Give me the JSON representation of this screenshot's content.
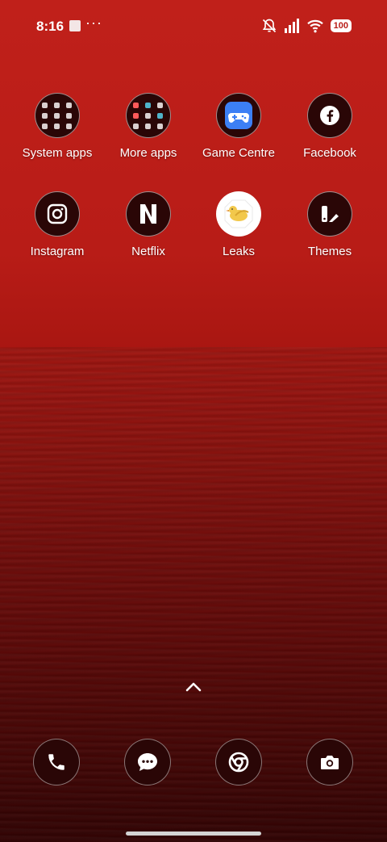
{
  "status_bar": {
    "time": "8:16",
    "overflow": "···",
    "battery": "100",
    "icons": [
      "media-stop-icon",
      "silent-mode-icon",
      "signal-icon",
      "wifi-icon",
      "battery-icon"
    ]
  },
  "apps": [
    {
      "label": "System apps",
      "icon": "folder-icon"
    },
    {
      "label": "More apps",
      "icon": "folder-icon"
    },
    {
      "label": "Game Centre",
      "icon": "game-controller-icon"
    },
    {
      "label": "Facebook",
      "icon": "facebook-icon"
    },
    {
      "label": "Instagram",
      "icon": "instagram-icon"
    },
    {
      "label": "Netflix",
      "icon": "netflix-icon"
    },
    {
      "label": "Leaks",
      "icon": "leaks-bird-icon"
    },
    {
      "label": "Themes",
      "icon": "themes-icon"
    }
  ],
  "dock": [
    {
      "icon": "phone-icon"
    },
    {
      "icon": "messages-icon"
    },
    {
      "icon": "chrome-icon"
    },
    {
      "icon": "camera-icon"
    }
  ],
  "colors": {
    "wallpaper_top": "#c0201a",
    "wallpaper_bottom": "#5a0606",
    "icon_bg": "#2a0606",
    "game_centre_blue": "#3c7ff5",
    "leaks_yellow": "#f2c84b"
  }
}
